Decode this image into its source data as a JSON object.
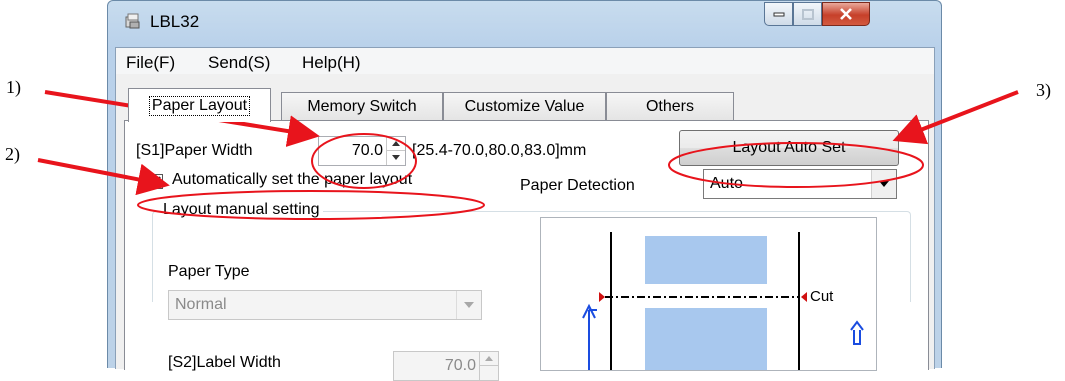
{
  "window": {
    "title": "LBL32",
    "controls": {
      "minimize": "minimize-icon",
      "maximize": "maximize-icon",
      "close": "close-icon"
    }
  },
  "menu": [
    {
      "label": "File(F)"
    },
    {
      "label": "Send(S)"
    },
    {
      "label": "Help(H)"
    }
  ],
  "tabs": [
    {
      "label": "Paper Layout",
      "selected": true
    },
    {
      "label": "Memory Switch"
    },
    {
      "label": "Customize Value"
    },
    {
      "label": "Others"
    }
  ],
  "paper_layout": {
    "paper_width_label": "[S1]Paper Width",
    "paper_width_value": "70.0",
    "paper_width_range": "[25.4-70.0,80.0,83.0]mm",
    "layout_auto_set_label": "Layout Auto Set",
    "auto_layout_checkbox_label": "Automatically set the paper layout",
    "auto_layout_checked": true,
    "paper_detection_label": "Paper Detection",
    "paper_detection_value": "Auto",
    "manual_group_title": "Layout manual setting",
    "paper_type_label": "Paper Type",
    "paper_type_value": "Normal",
    "label_width_label": "[S2]Label Width",
    "label_width_value": "70.0",
    "preview": {
      "cut_label": "Cut",
      "label_color": "#a8c8ee"
    }
  },
  "annotations": [
    "1)",
    "2)",
    "3)"
  ],
  "colors": {
    "annotation_red": "#e8141c"
  }
}
